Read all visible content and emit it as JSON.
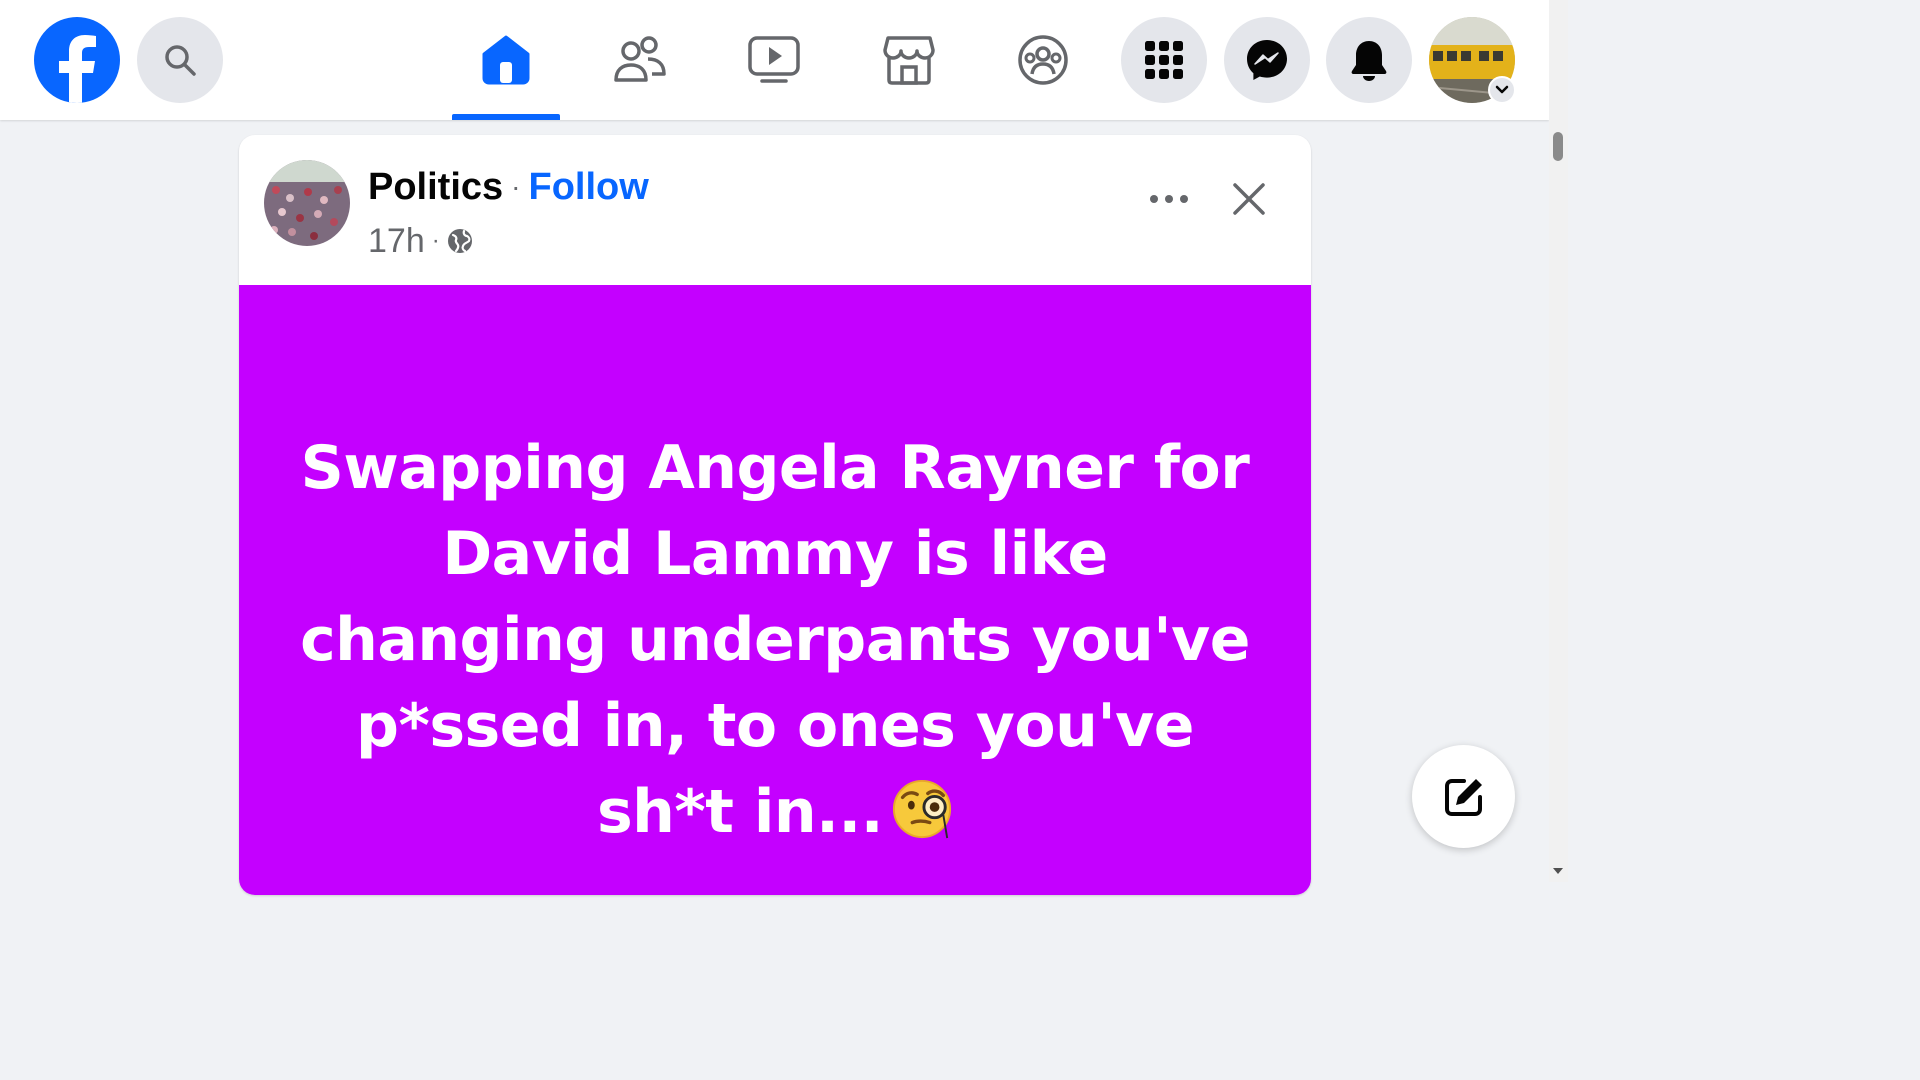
{
  "topbar": {
    "logo_icon": "facebook-logo-icon",
    "search_icon": "search-icon",
    "nav_tabs": [
      {
        "name": "home",
        "icon": "home-icon",
        "active": true
      },
      {
        "name": "friends",
        "icon": "friends-icon",
        "active": false
      },
      {
        "name": "video",
        "icon": "video-icon",
        "active": false
      },
      {
        "name": "marketplace",
        "icon": "marketplace-icon",
        "active": false
      },
      {
        "name": "groups",
        "icon": "groups-icon",
        "active": false
      }
    ],
    "right_buttons": [
      "menu-grid-icon",
      "messenger-icon",
      "notifications-bell-icon"
    ],
    "accent_color": "#0866ff"
  },
  "post": {
    "page_name": "Politics",
    "separator": "·",
    "follow_label": "Follow",
    "time": "17h",
    "visibility_icon": "globe-icon",
    "background_color": "#c400ff",
    "text": "Swapping Angela Rayner for David Lammy is like changing underpants you've p*ssed in, to ones you've sh*t in...",
    "emoji": "face-with-monocle"
  },
  "compose_button_icon": "compose-icon"
}
